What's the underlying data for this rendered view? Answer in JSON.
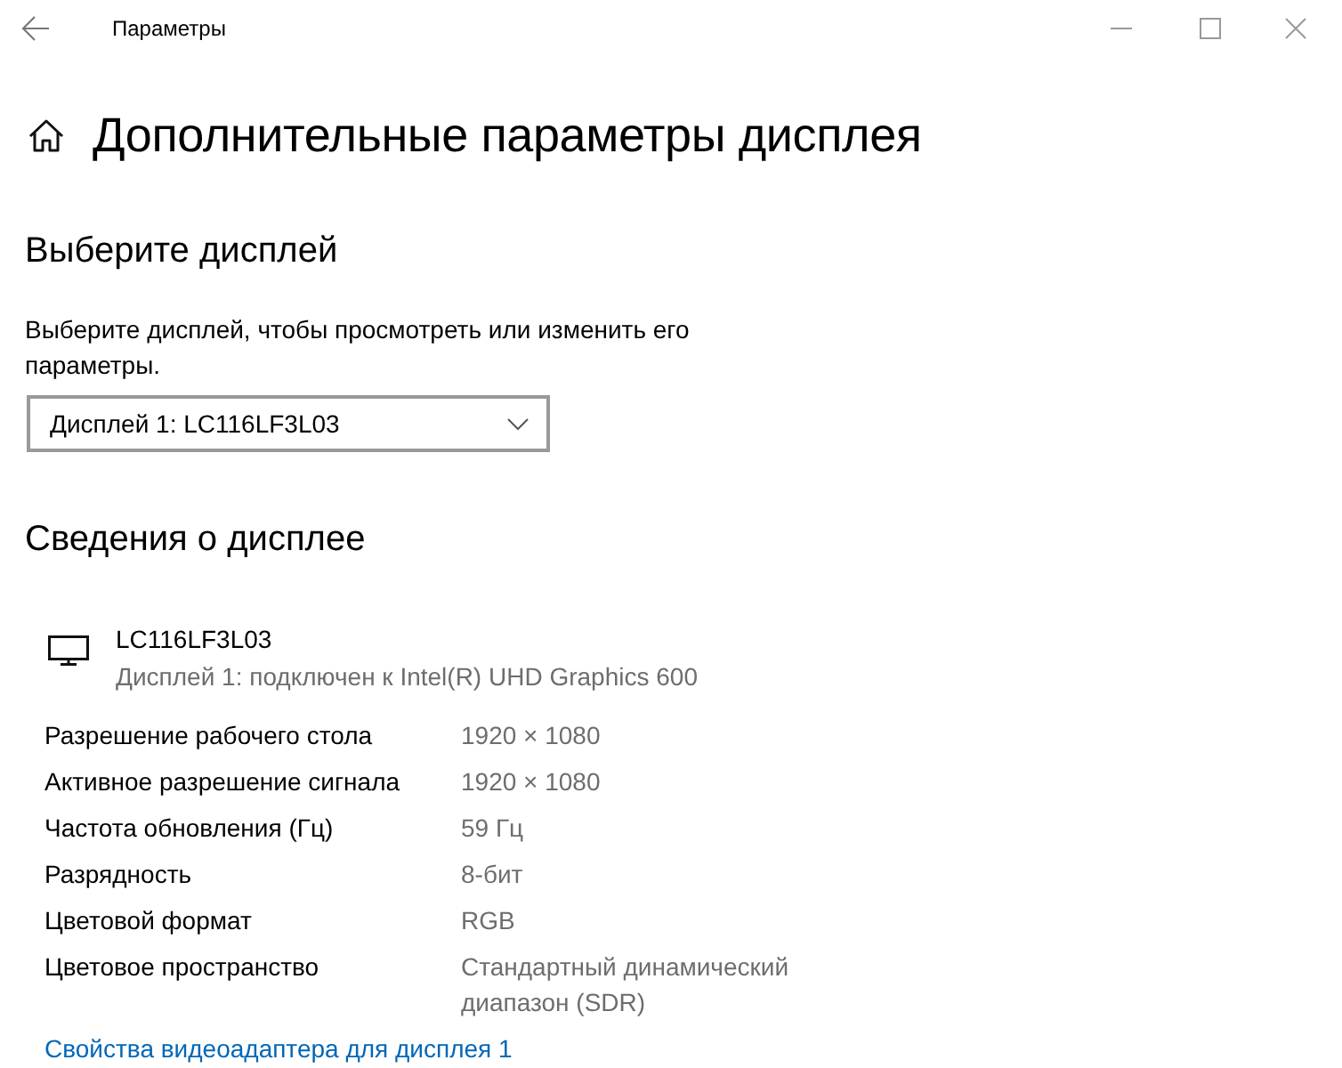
{
  "window": {
    "title": "Параметры"
  },
  "page": {
    "title": "Дополнительные параметры дисплея"
  },
  "choose_display": {
    "heading": "Выберите дисплей",
    "description": "Выберите дисплей, чтобы просмотреть или изменить его параметры.",
    "dropdown": {
      "value": "Дисплей 1: LC116LF3L03"
    }
  },
  "display_info": {
    "heading": "Сведения о дисплее",
    "display_name": "LC116LF3L03",
    "connection": "Дисплей 1: подключен к Intel(R) UHD Graphics 600",
    "properties": [
      {
        "label": "Разрешение рабочего стола",
        "value": "1920 × 1080"
      },
      {
        "label": "Активное разрешение сигнала",
        "value": "1920 × 1080"
      },
      {
        "label": "Частота обновления (Гц)",
        "value": "59 Гц"
      },
      {
        "label": "Разрядность",
        "value": "8-бит"
      },
      {
        "label": "Цветовой формат",
        "value": "RGB"
      },
      {
        "label": "Цветовое пространство",
        "value": "Стандартный динамический диапазон (SDR)"
      }
    ],
    "link": "Свойства видеоадаптера для дисплея 1"
  }
}
